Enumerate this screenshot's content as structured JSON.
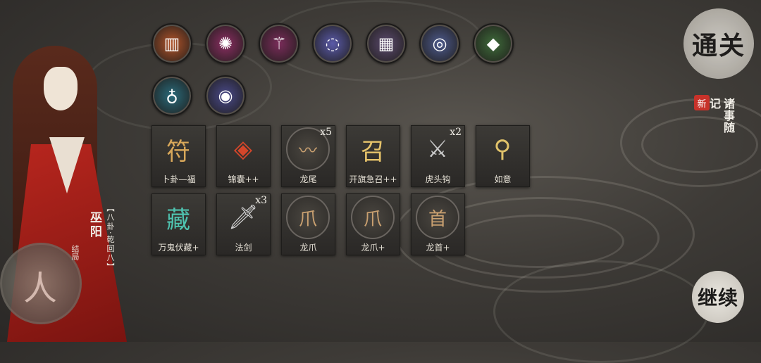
{
  "round_items_row1": [
    {
      "icon": "scroll-icon",
      "bg": "#b2542a",
      "glyph": "▥"
    },
    {
      "icon": "web-icon",
      "bg": "#8b2e62",
      "glyph": "✺"
    },
    {
      "icon": "staff-icon",
      "bg": "#7a2c5a",
      "glyph": "⚚"
    },
    {
      "icon": "pearls-icon",
      "bg": "#5a5aa8",
      "glyph": "◌"
    },
    {
      "icon": "bronze-plate-icon",
      "bg": "#5b4a6e",
      "glyph": "▦"
    },
    {
      "icon": "coil-icon",
      "bg": "#4d5a8c",
      "glyph": "◎"
    },
    {
      "icon": "jade-icon",
      "bg": "#3e6a3a",
      "glyph": "◆"
    }
  ],
  "round_items_row2": [
    {
      "icon": "lamp-icon",
      "bg": "#2a6a7a",
      "glyph": "♁"
    },
    {
      "icon": "black-pearl-icon",
      "bg": "#4a4a8a",
      "glyph": "◉"
    }
  ],
  "cards_row1": [
    {
      "name": "卜卦—福",
      "icon": "fortune-sigil-icon",
      "glyph": "符",
      "color": "#d9a85a",
      "count": ""
    },
    {
      "name": "锦囊++",
      "icon": "pouch-icon",
      "glyph": "◈",
      "color": "#d4462a",
      "count": ""
    },
    {
      "name": "龙尾",
      "icon": "dragon-tail-icon",
      "glyph": "〰",
      "color": "#c9a070",
      "count": "x5"
    },
    {
      "name": "开旗急召++",
      "icon": "flag-sigil-icon",
      "glyph": "召",
      "color": "#e6c36a",
      "count": ""
    },
    {
      "name": "虎头钩",
      "icon": "hook-swords-icon",
      "glyph": "⚔",
      "color": "#c8c8c8",
      "count": "x2"
    },
    {
      "name": "如意",
      "icon": "ruyi-scepter-icon",
      "glyph": "⚲",
      "color": "#e0c26a",
      "count": ""
    }
  ],
  "cards_row2": [
    {
      "name": "万鬼伏藏+",
      "icon": "ghost-sigil-icon",
      "glyph": "藏",
      "color": "#4fc3b0",
      "count": ""
    },
    {
      "name": "法剑",
      "icon": "dagger-icon",
      "glyph": "🗡",
      "color": "#d8d8d8",
      "count": "x3"
    },
    {
      "name": "龙爪",
      "icon": "dragon-claw-icon",
      "glyph": "爪",
      "color": "#c9a070",
      "count": ""
    },
    {
      "name": "龙爪+",
      "icon": "dragon-claw-plus-icon",
      "glyph": "爪",
      "color": "#c9a070",
      "count": ""
    },
    {
      "name": "龙首+",
      "icon": "dragon-head-icon",
      "glyph": "首",
      "color": "#c9a070",
      "count": ""
    }
  ],
  "character": {
    "name": "巫阳",
    "title": "【八卦·乾回八】",
    "stance": "结局",
    "emblem_glyph": "人"
  },
  "buttons": {
    "pass": "通关",
    "notes_new": "新",
    "notes": "诸事随记",
    "continue": "继续"
  }
}
